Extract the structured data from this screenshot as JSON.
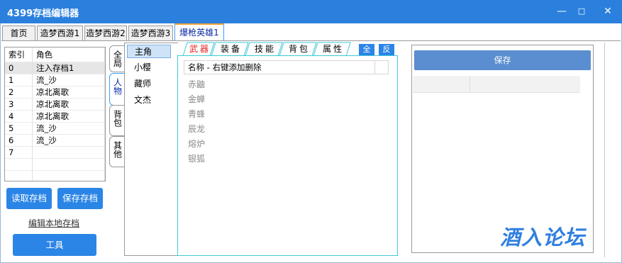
{
  "window": {
    "title": "4399存档编辑器",
    "minimize": "—",
    "maximize": "□",
    "close": "✕"
  },
  "top_tabs": [
    "首页",
    "造梦西游1",
    "造梦西游2",
    "造梦西游3",
    "爆枪英雄1"
  ],
  "save_table": {
    "headers": [
      "索引",
      "角色"
    ],
    "rows": [
      [
        "0",
        "注入存档1"
      ],
      [
        "1",
        "流_沙"
      ],
      [
        "2",
        "凉北离歌"
      ],
      [
        "3",
        "凉北离歌"
      ],
      [
        "4",
        "凉北离歌"
      ],
      [
        "5",
        "流_沙"
      ],
      [
        "6",
        "流_沙"
      ],
      [
        "7",
        ""
      ]
    ]
  },
  "left_buttons": {
    "read": "读取存档",
    "save": "保存存档",
    "edit_local": "编辑本地存档",
    "tools": "工具"
  },
  "vertical_tabs": [
    "全局",
    "人物",
    "背包",
    "其他"
  ],
  "characters": [
    "主角",
    "小樱",
    "藏师",
    "文杰"
  ],
  "weapon_tabs": [
    "武器",
    "装备",
    "技能",
    "背包",
    "属性"
  ],
  "select_buttons": {
    "all": "全",
    "invert": "反"
  },
  "list_header": "名称 - 右键添加删除",
  "weapons": [
    "赤鼬",
    "金蝉",
    "青蜂",
    "辰龙",
    "熔炉",
    "银狐"
  ],
  "right_panel": {
    "save_label": "保存"
  },
  "watermark": "酒入论坛",
  "colors": {
    "titlebar": "#2b80dd",
    "button": "#2b85e6",
    "save_button": "#5b8ed0",
    "active_tab_text": "#e02020",
    "panel_border": "#3ec9d8"
  }
}
